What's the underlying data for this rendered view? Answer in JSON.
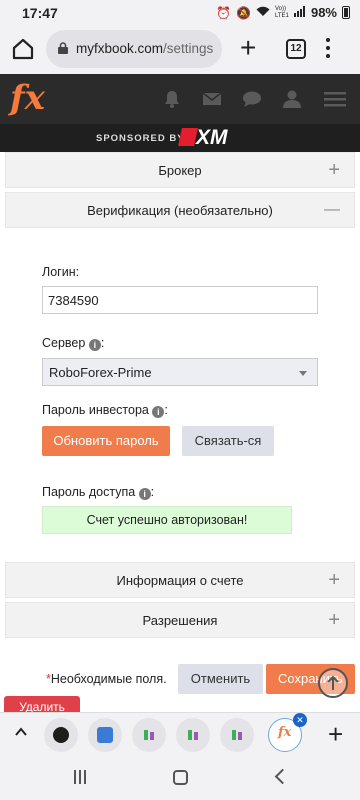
{
  "status_bar": {
    "time": "17:47",
    "network": "Vo)) LTE1",
    "battery": "98%"
  },
  "browser": {
    "domain": "myfxbook.com",
    "path": "/settings",
    "tab_count": "12",
    "icons": [
      "home-icon",
      "lock-icon",
      "plus-icon",
      "tabs-icon",
      "menu-icon"
    ]
  },
  "site_header": {
    "logo": "fx",
    "icons": [
      "bell-icon",
      "mail-icon",
      "chat-icon",
      "user-icon",
      "hamburger-icon"
    ],
    "sponsor_label": "SPONSORED BY",
    "sponsor_brand": "XM",
    "sponsor_color": "#e51e2f"
  },
  "panels": {
    "broker": {
      "title": "Брокер",
      "toggle": "+"
    },
    "verification": {
      "title": "Верификация (необязательно)",
      "toggle": "—"
    },
    "account_info": {
      "title": "Информация о счете",
      "toggle": "+"
    },
    "permissions": {
      "title": "Разрешения",
      "toggle": "+"
    }
  },
  "form": {
    "login_label": "Логин:",
    "login_value": "7384590",
    "server_label": "Сервер",
    "server_label_suffix": ":",
    "server_value": "RoboForex-Prime",
    "investor_password_label": "Пароль инвестора",
    "investor_password_suffix": ":",
    "update_password_button": "Обновить пароль",
    "connect_button": "Связать-ся",
    "access_password_label": "Пароль доступа",
    "access_password_suffix": ":",
    "success_message": "Счет успешно авторизован!",
    "info_glyph": "i"
  },
  "footer": {
    "required_star": "*",
    "required_text": "Необходимые поля.",
    "cancel_button": "Отменить",
    "save_button": "Сохранить",
    "delete_button": "Удалить"
  },
  "colors": {
    "accent_orange": "#f07c4c",
    "success_bg": "#dcfcd8",
    "header_dark": "#2b2b2b",
    "delete_red": "#e0404a"
  }
}
